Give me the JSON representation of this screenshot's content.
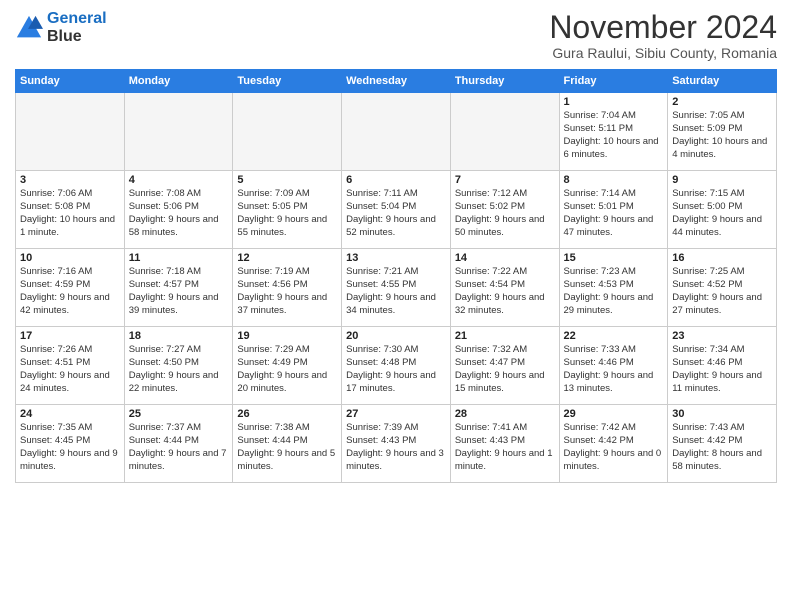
{
  "logo": {
    "line1": "General",
    "line2": "Blue"
  },
  "title": "November 2024",
  "subtitle": "Gura Raului, Sibiu County, Romania",
  "weekdays": [
    "Sunday",
    "Monday",
    "Tuesday",
    "Wednesday",
    "Thursday",
    "Friday",
    "Saturday"
  ],
  "weeks": [
    [
      {
        "day": "",
        "info": ""
      },
      {
        "day": "",
        "info": ""
      },
      {
        "day": "",
        "info": ""
      },
      {
        "day": "",
        "info": ""
      },
      {
        "day": "",
        "info": ""
      },
      {
        "day": "1",
        "info": "Sunrise: 7:04 AM\nSunset: 5:11 PM\nDaylight: 10 hours and 6 minutes."
      },
      {
        "day": "2",
        "info": "Sunrise: 7:05 AM\nSunset: 5:09 PM\nDaylight: 10 hours and 4 minutes."
      }
    ],
    [
      {
        "day": "3",
        "info": "Sunrise: 7:06 AM\nSunset: 5:08 PM\nDaylight: 10 hours and 1 minute."
      },
      {
        "day": "4",
        "info": "Sunrise: 7:08 AM\nSunset: 5:06 PM\nDaylight: 9 hours and 58 minutes."
      },
      {
        "day": "5",
        "info": "Sunrise: 7:09 AM\nSunset: 5:05 PM\nDaylight: 9 hours and 55 minutes."
      },
      {
        "day": "6",
        "info": "Sunrise: 7:11 AM\nSunset: 5:04 PM\nDaylight: 9 hours and 52 minutes."
      },
      {
        "day": "7",
        "info": "Sunrise: 7:12 AM\nSunset: 5:02 PM\nDaylight: 9 hours and 50 minutes."
      },
      {
        "day": "8",
        "info": "Sunrise: 7:14 AM\nSunset: 5:01 PM\nDaylight: 9 hours and 47 minutes."
      },
      {
        "day": "9",
        "info": "Sunrise: 7:15 AM\nSunset: 5:00 PM\nDaylight: 9 hours and 44 minutes."
      }
    ],
    [
      {
        "day": "10",
        "info": "Sunrise: 7:16 AM\nSunset: 4:59 PM\nDaylight: 9 hours and 42 minutes."
      },
      {
        "day": "11",
        "info": "Sunrise: 7:18 AM\nSunset: 4:57 PM\nDaylight: 9 hours and 39 minutes."
      },
      {
        "day": "12",
        "info": "Sunrise: 7:19 AM\nSunset: 4:56 PM\nDaylight: 9 hours and 37 minutes."
      },
      {
        "day": "13",
        "info": "Sunrise: 7:21 AM\nSunset: 4:55 PM\nDaylight: 9 hours and 34 minutes."
      },
      {
        "day": "14",
        "info": "Sunrise: 7:22 AM\nSunset: 4:54 PM\nDaylight: 9 hours and 32 minutes."
      },
      {
        "day": "15",
        "info": "Sunrise: 7:23 AM\nSunset: 4:53 PM\nDaylight: 9 hours and 29 minutes."
      },
      {
        "day": "16",
        "info": "Sunrise: 7:25 AM\nSunset: 4:52 PM\nDaylight: 9 hours and 27 minutes."
      }
    ],
    [
      {
        "day": "17",
        "info": "Sunrise: 7:26 AM\nSunset: 4:51 PM\nDaylight: 9 hours and 24 minutes."
      },
      {
        "day": "18",
        "info": "Sunrise: 7:27 AM\nSunset: 4:50 PM\nDaylight: 9 hours and 22 minutes."
      },
      {
        "day": "19",
        "info": "Sunrise: 7:29 AM\nSunset: 4:49 PM\nDaylight: 9 hours and 20 minutes."
      },
      {
        "day": "20",
        "info": "Sunrise: 7:30 AM\nSunset: 4:48 PM\nDaylight: 9 hours and 17 minutes."
      },
      {
        "day": "21",
        "info": "Sunrise: 7:32 AM\nSunset: 4:47 PM\nDaylight: 9 hours and 15 minutes."
      },
      {
        "day": "22",
        "info": "Sunrise: 7:33 AM\nSunset: 4:46 PM\nDaylight: 9 hours and 13 minutes."
      },
      {
        "day": "23",
        "info": "Sunrise: 7:34 AM\nSunset: 4:46 PM\nDaylight: 9 hours and 11 minutes."
      }
    ],
    [
      {
        "day": "24",
        "info": "Sunrise: 7:35 AM\nSunset: 4:45 PM\nDaylight: 9 hours and 9 minutes."
      },
      {
        "day": "25",
        "info": "Sunrise: 7:37 AM\nSunset: 4:44 PM\nDaylight: 9 hours and 7 minutes."
      },
      {
        "day": "26",
        "info": "Sunrise: 7:38 AM\nSunset: 4:44 PM\nDaylight: 9 hours and 5 minutes."
      },
      {
        "day": "27",
        "info": "Sunrise: 7:39 AM\nSunset: 4:43 PM\nDaylight: 9 hours and 3 minutes."
      },
      {
        "day": "28",
        "info": "Sunrise: 7:41 AM\nSunset: 4:43 PM\nDaylight: 9 hours and 1 minute."
      },
      {
        "day": "29",
        "info": "Sunrise: 7:42 AM\nSunset: 4:42 PM\nDaylight: 9 hours and 0 minutes."
      },
      {
        "day": "30",
        "info": "Sunrise: 7:43 AM\nSunset: 4:42 PM\nDaylight: 8 hours and 58 minutes."
      }
    ]
  ]
}
